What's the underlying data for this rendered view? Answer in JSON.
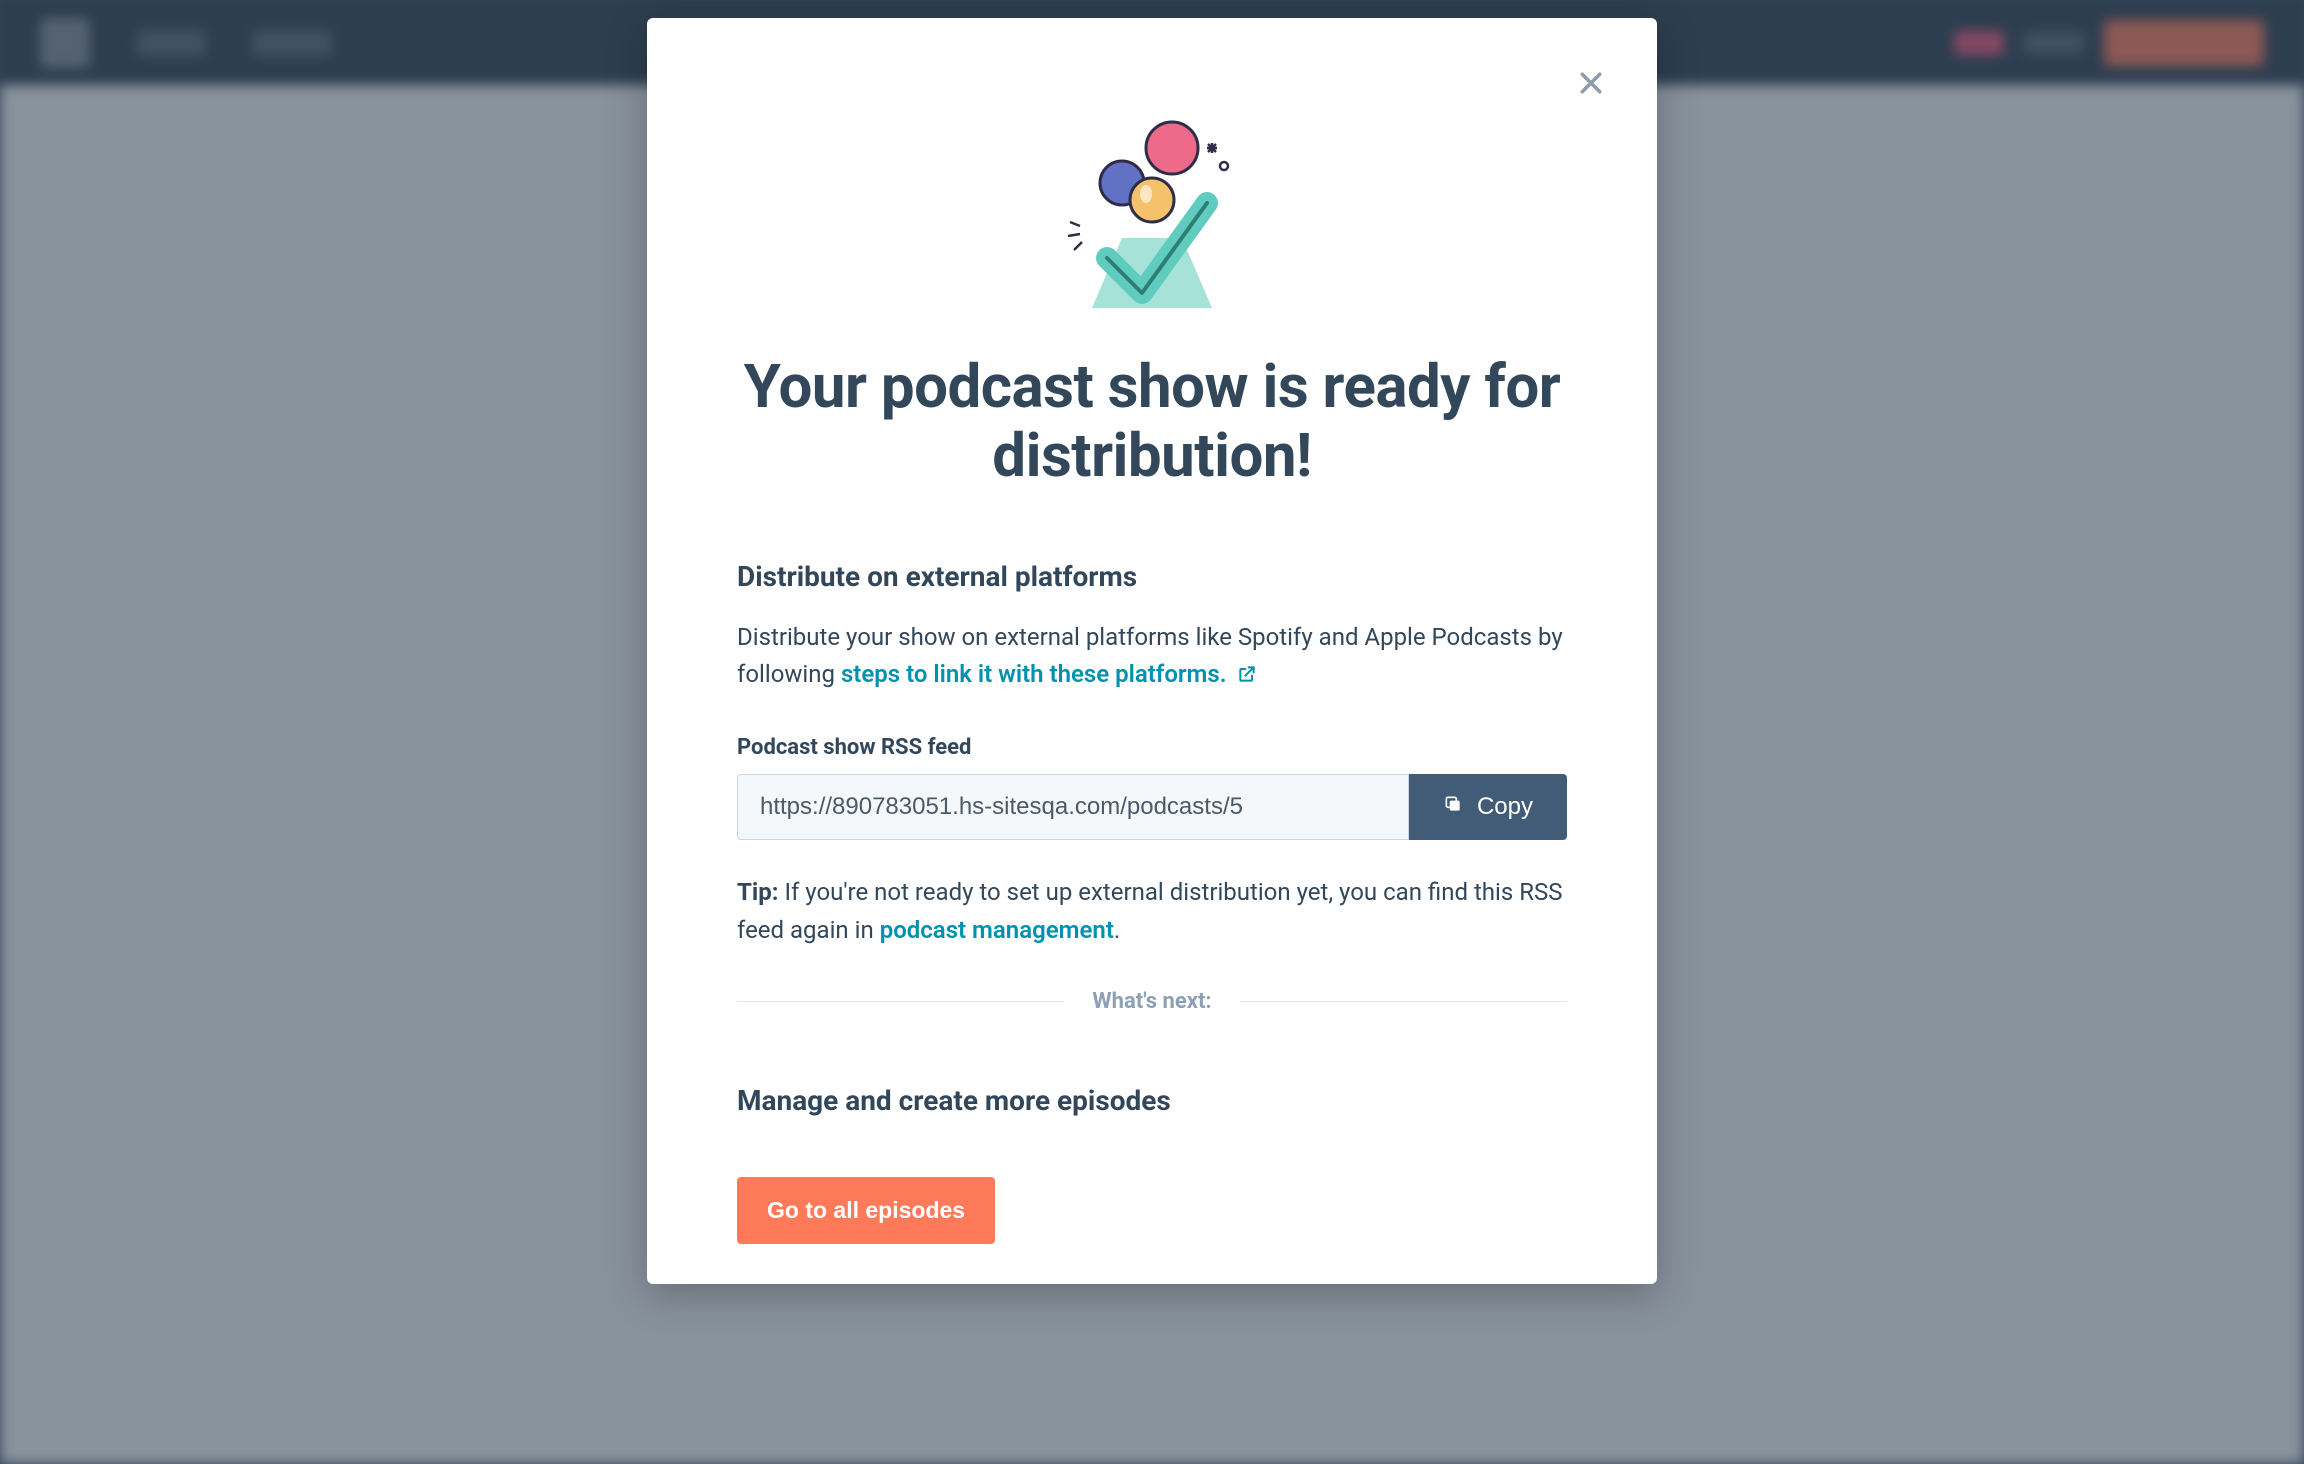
{
  "modal": {
    "title": "Your podcast show is ready for distribution!",
    "section_distribute": {
      "heading": "Distribute on external platforms",
      "body_prefix": "Distribute your show on external platforms like Spotify and Apple Podcasts by following ",
      "link_text": "steps to link it with these platforms."
    },
    "rss": {
      "label": "Podcast show RSS feed",
      "value": "https://890783051.hs-sitesqa.com/podcasts/5",
      "copy_label": "Copy"
    },
    "tip": {
      "label": "Tip:",
      "body_prefix": " If you're not ready to set up external distribution yet, you can find this RSS feed again in ",
      "link_text": "podcast management",
      "suffix": "."
    },
    "next_divider": "What's next:",
    "manage_heading": "Manage and create more episodes",
    "go_button": "Go to all episodes"
  },
  "colors": {
    "primary_text": "#33475b",
    "link": "#0091ae",
    "cta": "#ff7a59",
    "copy_btn": "#425b76"
  }
}
